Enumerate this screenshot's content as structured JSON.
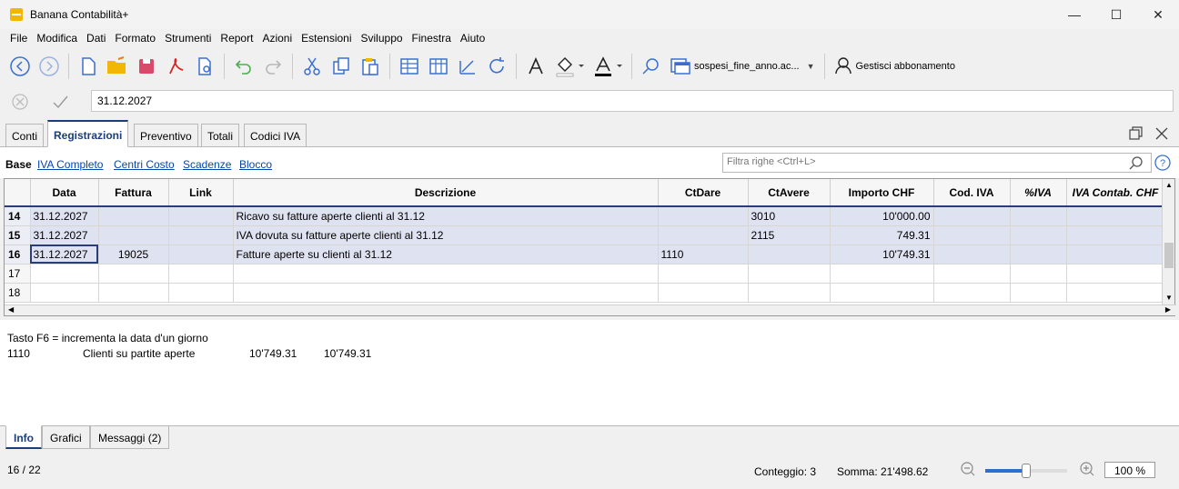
{
  "window": {
    "title": "Banana Contabilità+"
  },
  "menu": [
    "File",
    "Modifica",
    "Dati",
    "Formato",
    "Strumenti",
    "Report",
    "Azioni",
    "Estensioni",
    "Sviluppo",
    "Finestra",
    "Aiuto"
  ],
  "toolbar": {
    "file_name": "sospesi_fine_anno.ac...",
    "subscription_label": "Gestisci abbonamento"
  },
  "formula": {
    "value": "31.12.2027"
  },
  "tabs": [
    "Conti",
    "Registrazioni",
    "Preventivo",
    "Totali",
    "Codici IVA"
  ],
  "active_tab": "Registrazioni",
  "views": [
    "Base",
    "IVA Completo",
    "Centri Costo",
    "Scadenze",
    "Blocco"
  ],
  "filter": {
    "placeholder": "Filtra righe <Ctrl+L>"
  },
  "table": {
    "columns": [
      "Data",
      "Fattura",
      "Link",
      "Descrizione",
      "CtDare",
      "CtAvere",
      "Importo CHF",
      "Cod. IVA",
      "%IVA",
      "IVA Contab. CHF"
    ],
    "rows": [
      {
        "n": "14",
        "data": "31.12.2027",
        "fattura": "",
        "link": "",
        "descrizione": "Ricavo su fatture aperte clienti al 31.12",
        "ctdare": "",
        "ctavere": "3010",
        "importo": "10'000.00"
      },
      {
        "n": "15",
        "data": "31.12.2027",
        "fattura": "",
        "link": "",
        "descrizione": "IVA dovuta su fatture aperte clienti al 31.12",
        "ctdare": "",
        "ctavere": "2115",
        "importo": "749.31"
      },
      {
        "n": "16",
        "data": "31.12.2027",
        "fattura": "19025",
        "link": "",
        "descrizione": "Fatture aperte su clienti al 31.12",
        "ctdare": "1110",
        "ctavere": "",
        "importo": "10'749.31"
      },
      {
        "n": "17",
        "data": "",
        "fattura": "",
        "link": "",
        "descrizione": "",
        "ctdare": "",
        "ctavere": "",
        "importo": ""
      },
      {
        "n": "18",
        "data": "",
        "fattura": "",
        "link": "",
        "descrizione": "",
        "ctdare": "",
        "ctavere": "",
        "importo": ""
      }
    ]
  },
  "info": {
    "hint": "Tasto F6 = incrementa la data d'un giorno",
    "account": "1110",
    "account_name": "Clienti su partite aperte",
    "amount1": "10'749.31",
    "amount2": "10'749.31"
  },
  "bottom_tabs": [
    "Info",
    "Grafici",
    "Messaggi (2)"
  ],
  "status": {
    "position": "16 / 22",
    "count": "Conteggio: 3",
    "sum": "Somma: 21'498.62",
    "zoom": "100 %"
  }
}
